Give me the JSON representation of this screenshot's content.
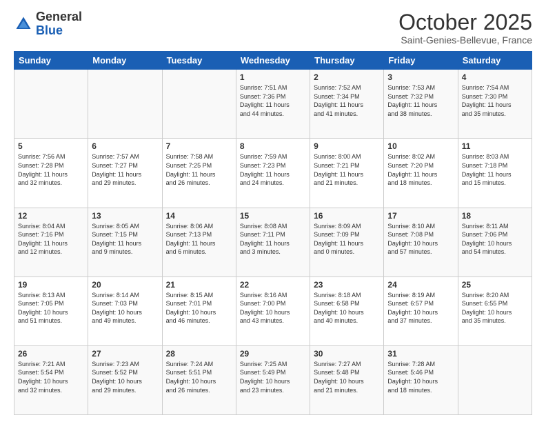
{
  "header": {
    "logo_general": "General",
    "logo_blue": "Blue",
    "month_title": "October 2025",
    "subtitle": "Saint-Genies-Bellevue, France"
  },
  "weekdays": [
    "Sunday",
    "Monday",
    "Tuesday",
    "Wednesday",
    "Thursday",
    "Friday",
    "Saturday"
  ],
  "weeks": [
    [
      {
        "day": "",
        "info": ""
      },
      {
        "day": "",
        "info": ""
      },
      {
        "day": "",
        "info": ""
      },
      {
        "day": "1",
        "info": "Sunrise: 7:51 AM\nSunset: 7:36 PM\nDaylight: 11 hours\nand 44 minutes."
      },
      {
        "day": "2",
        "info": "Sunrise: 7:52 AM\nSunset: 7:34 PM\nDaylight: 11 hours\nand 41 minutes."
      },
      {
        "day": "3",
        "info": "Sunrise: 7:53 AM\nSunset: 7:32 PM\nDaylight: 11 hours\nand 38 minutes."
      },
      {
        "day": "4",
        "info": "Sunrise: 7:54 AM\nSunset: 7:30 PM\nDaylight: 11 hours\nand 35 minutes."
      }
    ],
    [
      {
        "day": "5",
        "info": "Sunrise: 7:56 AM\nSunset: 7:28 PM\nDaylight: 11 hours\nand 32 minutes."
      },
      {
        "day": "6",
        "info": "Sunrise: 7:57 AM\nSunset: 7:27 PM\nDaylight: 11 hours\nand 29 minutes."
      },
      {
        "day": "7",
        "info": "Sunrise: 7:58 AM\nSunset: 7:25 PM\nDaylight: 11 hours\nand 26 minutes."
      },
      {
        "day": "8",
        "info": "Sunrise: 7:59 AM\nSunset: 7:23 PM\nDaylight: 11 hours\nand 24 minutes."
      },
      {
        "day": "9",
        "info": "Sunrise: 8:00 AM\nSunset: 7:21 PM\nDaylight: 11 hours\nand 21 minutes."
      },
      {
        "day": "10",
        "info": "Sunrise: 8:02 AM\nSunset: 7:20 PM\nDaylight: 11 hours\nand 18 minutes."
      },
      {
        "day": "11",
        "info": "Sunrise: 8:03 AM\nSunset: 7:18 PM\nDaylight: 11 hours\nand 15 minutes."
      }
    ],
    [
      {
        "day": "12",
        "info": "Sunrise: 8:04 AM\nSunset: 7:16 PM\nDaylight: 11 hours\nand 12 minutes."
      },
      {
        "day": "13",
        "info": "Sunrise: 8:05 AM\nSunset: 7:15 PM\nDaylight: 11 hours\nand 9 minutes."
      },
      {
        "day": "14",
        "info": "Sunrise: 8:06 AM\nSunset: 7:13 PM\nDaylight: 11 hours\nand 6 minutes."
      },
      {
        "day": "15",
        "info": "Sunrise: 8:08 AM\nSunset: 7:11 PM\nDaylight: 11 hours\nand 3 minutes."
      },
      {
        "day": "16",
        "info": "Sunrise: 8:09 AM\nSunset: 7:09 PM\nDaylight: 11 hours\nand 0 minutes."
      },
      {
        "day": "17",
        "info": "Sunrise: 8:10 AM\nSunset: 7:08 PM\nDaylight: 10 hours\nand 57 minutes."
      },
      {
        "day": "18",
        "info": "Sunrise: 8:11 AM\nSunset: 7:06 PM\nDaylight: 10 hours\nand 54 minutes."
      }
    ],
    [
      {
        "day": "19",
        "info": "Sunrise: 8:13 AM\nSunset: 7:05 PM\nDaylight: 10 hours\nand 51 minutes."
      },
      {
        "day": "20",
        "info": "Sunrise: 8:14 AM\nSunset: 7:03 PM\nDaylight: 10 hours\nand 49 minutes."
      },
      {
        "day": "21",
        "info": "Sunrise: 8:15 AM\nSunset: 7:01 PM\nDaylight: 10 hours\nand 46 minutes."
      },
      {
        "day": "22",
        "info": "Sunrise: 8:16 AM\nSunset: 7:00 PM\nDaylight: 10 hours\nand 43 minutes."
      },
      {
        "day": "23",
        "info": "Sunrise: 8:18 AM\nSunset: 6:58 PM\nDaylight: 10 hours\nand 40 minutes."
      },
      {
        "day": "24",
        "info": "Sunrise: 8:19 AM\nSunset: 6:57 PM\nDaylight: 10 hours\nand 37 minutes."
      },
      {
        "day": "25",
        "info": "Sunrise: 8:20 AM\nSunset: 6:55 PM\nDaylight: 10 hours\nand 35 minutes."
      }
    ],
    [
      {
        "day": "26",
        "info": "Sunrise: 7:21 AM\nSunset: 5:54 PM\nDaylight: 10 hours\nand 32 minutes."
      },
      {
        "day": "27",
        "info": "Sunrise: 7:23 AM\nSunset: 5:52 PM\nDaylight: 10 hours\nand 29 minutes."
      },
      {
        "day": "28",
        "info": "Sunrise: 7:24 AM\nSunset: 5:51 PM\nDaylight: 10 hours\nand 26 minutes."
      },
      {
        "day": "29",
        "info": "Sunrise: 7:25 AM\nSunset: 5:49 PM\nDaylight: 10 hours\nand 23 minutes."
      },
      {
        "day": "30",
        "info": "Sunrise: 7:27 AM\nSunset: 5:48 PM\nDaylight: 10 hours\nand 21 minutes."
      },
      {
        "day": "31",
        "info": "Sunrise: 7:28 AM\nSunset: 5:46 PM\nDaylight: 10 hours\nand 18 minutes."
      },
      {
        "day": "",
        "info": ""
      }
    ]
  ]
}
